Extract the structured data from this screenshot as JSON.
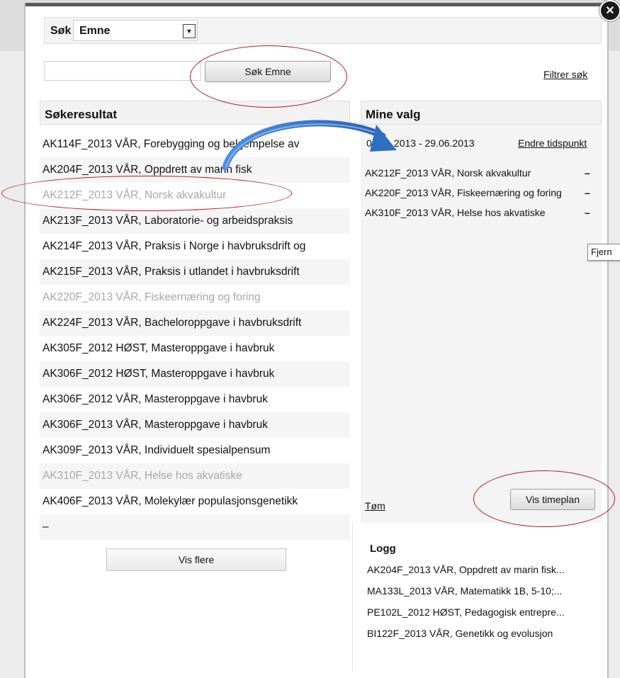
{
  "search": {
    "label": "Søk",
    "type_value": "Emne",
    "button_label": "Søk Emne",
    "filter_link": "Filtrer søk",
    "input_value": ""
  },
  "results": {
    "header": "Søkeresultat",
    "items": [
      {
        "text": "AK114F_2013 VÅR, Forebygging og bekjempelse av",
        "dimmed": false
      },
      {
        "text": "AK204F_2013 VÅR, Oppdrett av marin fisk",
        "dimmed": false
      },
      {
        "text": "AK212F_2013 VÅR, Norsk akvakultur",
        "dimmed": true
      },
      {
        "text": "AK213F_2013 VÅR, Laboratorie- og arbeidspraksis",
        "dimmed": false
      },
      {
        "text": "AK214F_2013 VÅR, Praksis i Norge i havbruksdrift og",
        "dimmed": false
      },
      {
        "text": "AK215F_2013 VÅR, Praksis i utlandet i havbruksdrift",
        "dimmed": false
      },
      {
        "text": "AK220F_2013 VÅR, Fiskeernæring og foring",
        "dimmed": true
      },
      {
        "text": "AK224F_2013 VÅR, Bacheloroppgave i havbruksdrift",
        "dimmed": false
      },
      {
        "text": "AK305F_2012 HØST, Masteroppgave i havbruk",
        "dimmed": false
      },
      {
        "text": "AK306F_2012 HØST, Masteroppgave i havbruk",
        "dimmed": false
      },
      {
        "text": "AK306F_2012 VÅR, Masteroppgave i havbruk",
        "dimmed": false
      },
      {
        "text": "AK306F_2013 VÅR, Masteroppgave i havbruk",
        "dimmed": false
      },
      {
        "text": "AK309F_2013 VÅR, Individuelt spesialpensum",
        "dimmed": false
      },
      {
        "text": "AK310F_2013 VÅR, Helse hos akvatiske",
        "dimmed": true
      },
      {
        "text": "AK406F_2013 VÅR, Molekylær populasjonsgenetikk",
        "dimmed": false
      },
      {
        "text": "–",
        "dimmed": false
      }
    ],
    "more_button": "Vis flere"
  },
  "mine": {
    "header": "Mine valg",
    "period": "01.01.2013 - 29.06.2013",
    "change_link": "Endre tidspunkt",
    "selected": [
      "AK212F_2013 VÅR, Norsk akvakultur",
      "AK220F_2013 VÅR, Fiskeernæring og foring",
      "AK310F_2013 VÅR, Helse hos akvatiske"
    ],
    "remove_symbol": "–",
    "tooltip": "Fjern",
    "clear_link": "Tøm",
    "schedule_button": "Vis timeplan"
  },
  "log": {
    "title": "Logg",
    "items": [
      "AK204F_2013 VÅR, Oppdrett av marin fisk...",
      "MA133L_2013 VÅR, Matematikk 1B, 5-10;...",
      "PE102L_2012 HØST, Pedagogisk entrepre...",
      "BI122F_2013 VÅR, Genetikk og evolusjon"
    ]
  },
  "close_symbol": "✕",
  "colors": {
    "annotation_ellipse": "#b01c1c",
    "annotation_arrow": "#2f6fc2",
    "dimmed_text": "#a8a8a8"
  }
}
